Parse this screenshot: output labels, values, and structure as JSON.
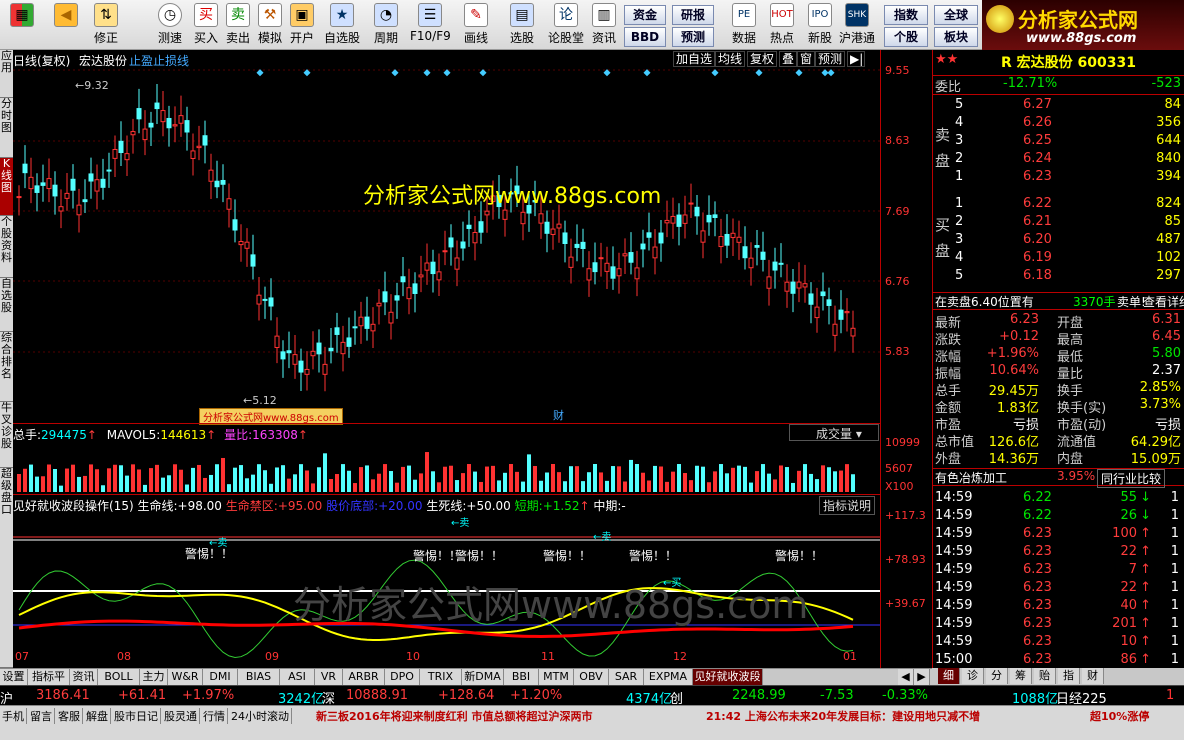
{
  "toolbar": {
    "items": [
      {
        "label": "",
        "icon": "windows-icon"
      },
      {
        "label": "",
        "icon": "back-arrow-icon"
      },
      {
        "label": "修正",
        "icon": "up-down-icon"
      },
      {
        "label": "测速",
        "icon": "clock-icon"
      },
      {
        "label": "买入",
        "icon": "buy-icon"
      },
      {
        "label": "卖出",
        "icon": "sell-icon"
      },
      {
        "label": "模拟",
        "icon": "hammer-icon"
      },
      {
        "label": "开户",
        "icon": "lock-icon"
      },
      {
        "label": "自选股",
        "icon": "star-icon"
      },
      {
        "label": "周期",
        "icon": "period-icon"
      },
      {
        "label": "F10/F9",
        "icon": "f10-icon"
      },
      {
        "label": "画线",
        "icon": "pen-icon"
      },
      {
        "label": "选股",
        "icon": "filter-icon"
      },
      {
        "label": "论股堂",
        "icon": "forum-icon"
      },
      {
        "label": "资讯",
        "icon": "news-icon"
      }
    ],
    "right_buttons": [
      "资金",
      "研报",
      "BBD",
      "预测"
    ],
    "more": [
      {
        "label": "数据",
        "icon": "pe-icon"
      },
      {
        "label": "热点",
        "icon": "hot-icon"
      },
      {
        "label": "新股",
        "icon": "ipo-icon"
      },
      {
        "label": "沪港通",
        "icon": "hk-icon"
      }
    ],
    "index_buttons": [
      "指数",
      "全球",
      "个股",
      "板块"
    ],
    "logo_title": "分析家公式网",
    "logo_url": "www.88gs.com"
  },
  "left_tabs": [
    "应用",
    "分时图",
    "K线图",
    "个股资料",
    "自选股",
    "综合排名",
    "牛叉诊股",
    "超级盘口"
  ],
  "chart": {
    "header_left": "日线(复权)",
    "stock_name": "宏达股份",
    "header_link": "止盈止损线",
    "panel_buttons": [
      "加自选",
      "均线",
      "复权",
      "叠",
      "窗",
      "预测"
    ],
    "high_label": "9.32",
    "low_label": "5.12",
    "watermark_center": "分析家公式网www.88gs.com",
    "watermark_small": "分析家公式网www.88gs.com",
    "fin_tag": "财",
    "vol_header": {
      "total_label": "总手:",
      "total": "294475",
      "mavol_label": "MAVOL5:",
      "mavol": "144613",
      "ratio_label": "量比:",
      "ratio": "163308",
      "dropdown": "成交量"
    },
    "ind_header": {
      "name": "见好就收波段操作(15)",
      "life_label": "生命线:",
      "life": "+98.00",
      "danger_label": "生命禁区:",
      "danger": "+95.00",
      "blue_label": "股价底部:",
      "blue": "+20.00",
      "death_label": "生死线:",
      "death": "+50.00",
      "short_label": "短期:",
      "short": "+1.52",
      "mid_label": "中期:",
      "mid": "-",
      "explain": "指标说明"
    },
    "warnings": [
      "警惕！！",
      "警惕！！",
      "警惕！！",
      "警惕！！",
      "警惕！！",
      "警惕！！"
    ],
    "sell_tag": "←卖",
    "buy_tag": "←买",
    "bg_watermark": "分析家公式网www.88gs.com",
    "x_labels": [
      "07",
      "08",
      "09",
      "10",
      "11",
      "12",
      "01"
    ]
  },
  "yaxis": {
    "price": [
      "9.55",
      "8.63",
      "7.69",
      "6.76",
      "5.83"
    ],
    "volume": [
      "10999",
      "5607",
      "X100"
    ],
    "indicator": [
      "+117.3",
      "+78.93",
      "+39.67"
    ]
  },
  "quote": {
    "title": "R 宏达股份 600331",
    "ratio_label": "委比",
    "ratio": "-12.71%",
    "diff": "-523",
    "sell_label": "卖盘",
    "buy_label": "买盘",
    "sell": [
      [
        "5",
        "6.27",
        "84"
      ],
      [
        "4",
        "6.26",
        "356"
      ],
      [
        "3",
        "6.25",
        "644"
      ],
      [
        "2",
        "6.24",
        "840"
      ],
      [
        "1",
        "6.23",
        "394"
      ]
    ],
    "buy": [
      [
        "1",
        "6.22",
        "824"
      ],
      [
        "2",
        "6.21",
        "85"
      ],
      [
        "3",
        "6.20",
        "487"
      ],
      [
        "4",
        "6.19",
        "102"
      ],
      [
        "5",
        "6.18",
        "297"
      ]
    ],
    "note": "在卖盘6.40位置有",
    "note_vol": "3370手",
    "note_type": "卖单!",
    "note_link": "查看详细",
    "stats": [
      [
        "最新",
        "6.23",
        "开盘",
        "6.31"
      ],
      [
        "涨跌",
        "+0.12",
        "最高",
        "6.45"
      ],
      [
        "涨幅",
        "+1.96%",
        "最低",
        "5.80"
      ],
      [
        "振幅",
        "10.64%",
        "量比",
        "2.37"
      ],
      [
        "总手",
        "29.45万",
        "换手",
        "2.85%"
      ],
      [
        "金额",
        "1.83亿",
        "换手(实)",
        "3.73%"
      ],
      [
        "市盈",
        "亏损",
        "市盈(动)",
        "亏损"
      ],
      [
        "总市值",
        "126.6亿",
        "流通值",
        "64.29亿"
      ],
      [
        "外盘",
        "14.36万",
        "内盘",
        "15.09万"
      ]
    ],
    "industry": "有色冶炼加工",
    "industry_pct": "3.95%",
    "industry_btn": "同行业比较",
    "ticks": [
      [
        "14:59",
        "6.22",
        "55",
        "1"
      ],
      [
        "14:59",
        "6.22",
        "26",
        "1"
      ],
      [
        "14:59",
        "6.23",
        "100",
        "1"
      ],
      [
        "14:59",
        "6.23",
        "22",
        "1"
      ],
      [
        "14:59",
        "6.23",
        "7",
        "1"
      ],
      [
        "14:59",
        "6.23",
        "22",
        "1"
      ],
      [
        "14:59",
        "6.23",
        "40",
        "1"
      ],
      [
        "14:59",
        "6.23",
        "201",
        "1"
      ],
      [
        "14:59",
        "6.23",
        "10",
        "1"
      ],
      [
        "15:00",
        "6.23",
        "86",
        "1"
      ]
    ],
    "tick_dirs": [
      "dn",
      "dn",
      "up",
      "up",
      "up",
      "up",
      "up",
      "up",
      "up",
      "up"
    ]
  },
  "bottom_tabs": [
    "设置",
    "指标平台",
    "资讯",
    "BOLL",
    "主力",
    "W&R",
    "DMI",
    "BIAS",
    "ASI",
    "VR",
    "ARBR",
    "DPO",
    "TRIX",
    "新DMA",
    "BBI",
    "MTM",
    "OBV",
    "SAR",
    "EXPMA",
    "见好就收波段操作"
  ],
  "right_tabs": [
    "细",
    "诊",
    "分",
    "筹",
    "贻",
    "指",
    "财"
  ],
  "status": {
    "sh_label": "沪",
    "sh": "3186.41",
    "sh_chg": "+61.41",
    "sh_pct": "+1.97%",
    "sh_amt": "3242亿",
    "sz_label": "深",
    "sz": "10888.91",
    "sz_chg": "+128.64",
    "sz_pct": "+1.20%",
    "sz_amt": "4374亿",
    "cy_label": "创",
    "cy": "2248.99",
    "cy_chg": "-7.53",
    "cy_pct": "-0.33%",
    "cy_amt": "1088亿",
    "rj_label": "日经225"
  },
  "ticker": {
    "buttons": [
      "手机",
      "留言",
      "客服",
      "解盘",
      "股市日记",
      "股灵通",
      "行情",
      "24小时滚动"
    ],
    "news1": "新三板2016年将迎来制度红利 市值总额将超过沪深两市",
    "news2": "21:42 上海公布未来20年发展目标：建设用地只减不增",
    "news3": "超10%涨停"
  }
}
